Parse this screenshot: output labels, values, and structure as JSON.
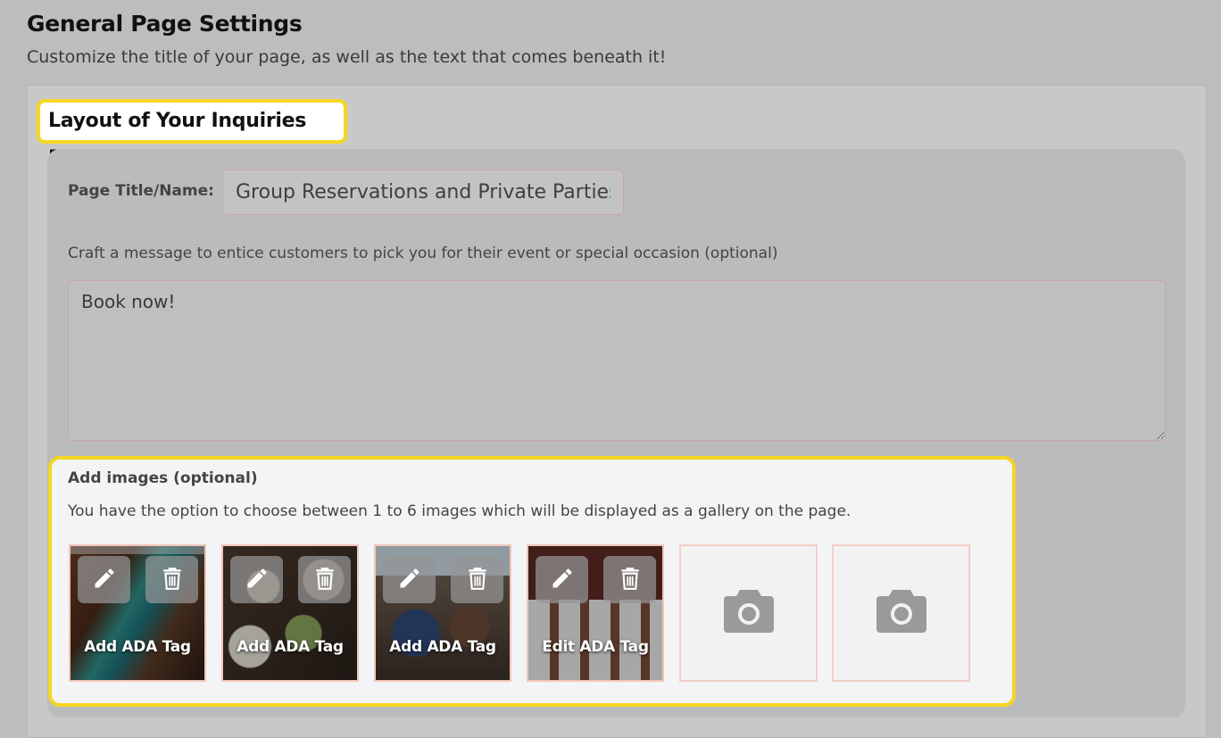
{
  "header": {
    "title": "General Page Settings",
    "subtitle": "Customize the title of your page, as well as the text that comes beneath it!"
  },
  "section": {
    "title": "Layout of Your Inquiries Page"
  },
  "form": {
    "page_title_label": "Page Title/Name:",
    "page_title_value": "Group Reservations and Private Parties",
    "message_label": "Craft a message to entice customers to pick you for their event or special occasion (optional)",
    "message_value": "Book now!"
  },
  "images": {
    "title": "Add images (optional)",
    "description": "You have the option to choose between 1 to 6 images which will be displayed as a gallery on the page.",
    "items": [
      {
        "ada_label": "Add ADA Tag"
      },
      {
        "ada_label": "Add ADA Tag"
      },
      {
        "ada_label": "Add ADA Tag"
      },
      {
        "ada_label": "Edit ADA Tag"
      }
    ],
    "empty_slots": 2
  },
  "colors": {
    "highlight": "#f5d623",
    "background": "#bdbdbd",
    "card": "#bbbbbb",
    "images_box": "#f3f4f5"
  },
  "icons": [
    "pencil-icon",
    "trash-icon",
    "camera-icon"
  ]
}
